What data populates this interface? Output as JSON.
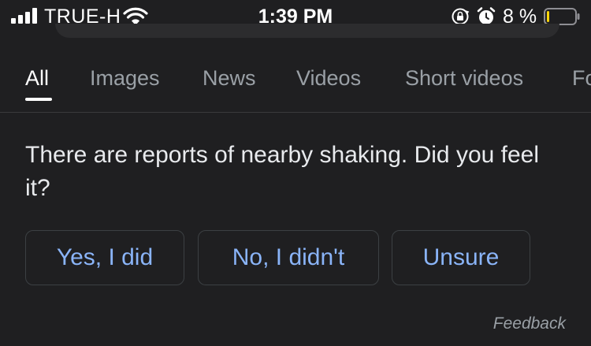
{
  "status_bar": {
    "carrier": "TRUE-H",
    "time": "1:39 PM",
    "battery_percent": "8 %",
    "battery_level": 0.08,
    "icons": [
      "signal-icon",
      "wifi-icon",
      "rotation-lock-icon",
      "alarm-icon",
      "battery-icon"
    ]
  },
  "tabs": [
    {
      "label": "All",
      "active": true
    },
    {
      "label": "Images",
      "active": false
    },
    {
      "label": "News",
      "active": false
    },
    {
      "label": "Videos",
      "active": false
    },
    {
      "label": "Short videos",
      "active": false
    },
    {
      "label": "Fo",
      "active": false
    }
  ],
  "prompt": {
    "question": "There are reports of nearby shaking. Did you feel it?",
    "options": [
      "Yes, I did",
      "No, I didn't",
      "Unsure"
    ]
  },
  "footer": {
    "feedback_label": "Feedback"
  },
  "colors": {
    "background": "#1f1f21",
    "accent": "#8ab4f8",
    "battery_low": "#ffd60a"
  }
}
